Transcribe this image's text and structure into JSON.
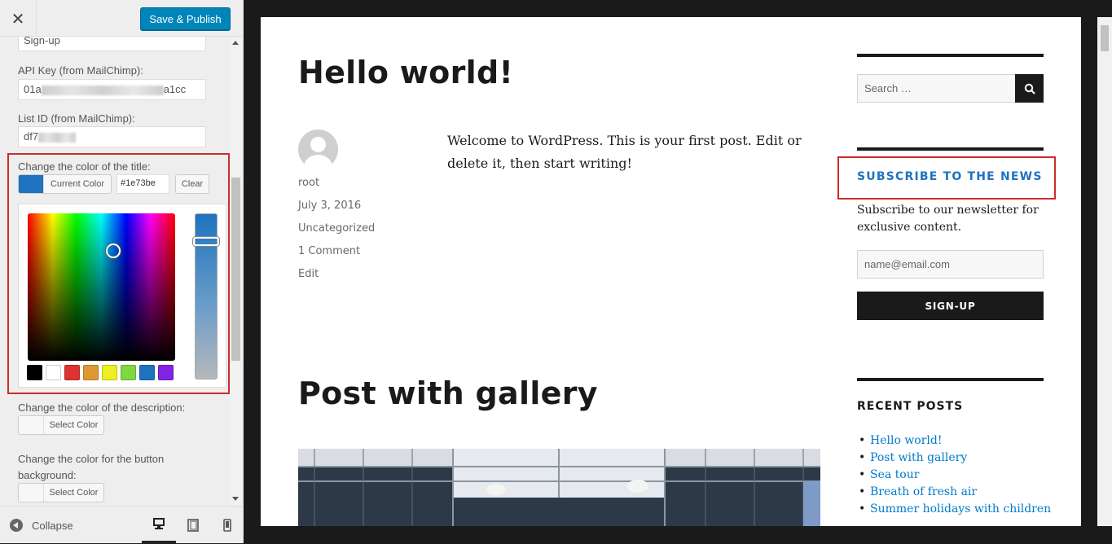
{
  "customizer": {
    "close_label": "✕",
    "publish_label": "Save & Publish",
    "fields": {
      "button_text_value": "Sign-up",
      "api_key_label": "API Key (from MailChimp):",
      "api_key_prefix": "01a",
      "api_key_suffix": "a1cc",
      "list_id_label": "List ID (from MailChimp):",
      "list_id_prefix": "df7"
    },
    "title_color": {
      "label": "Change the color of the title:",
      "button_label": "Current Color",
      "current_color": "#1e73be",
      "hex_value": "#1e73be",
      "clear_label": "Clear",
      "palette": [
        "#000000",
        "#ffffff",
        "#dd3333",
        "#dd9933",
        "#eeee22",
        "#81d742",
        "#1e73be",
        "#8224e3"
      ]
    },
    "description_color": {
      "label": "Change the color of the description:",
      "button_label": "Select Color"
    },
    "button_bg_color": {
      "label_line1": "Change the color for the button",
      "label_line2": "background:",
      "button_label": "Select Color"
    },
    "footer": {
      "collapse_label": "Collapse",
      "devices": [
        "desktop-icon",
        "tablet-icon",
        "mobile-icon"
      ]
    }
  },
  "preview": {
    "post1": {
      "title": "Hello world!",
      "author": "root",
      "date": "July 3, 2016",
      "category": "Uncategorized",
      "comments": "1 Comment",
      "edit": "Edit",
      "body": "Welcome to WordPress. This is your first post. Edit or delete it, then start writing!"
    },
    "post2": {
      "title": "Post with gallery"
    },
    "sidebar": {
      "search_placeholder": "Search …",
      "subscribe_title": "SUBSCRIBE TO THE NEWS",
      "subscribe_desc": "Subscribe to our newsletter for exclusive content.",
      "email_placeholder": "name@email.com",
      "signup_label": "SIGN-UP",
      "recent_title": "RECENT POSTS",
      "recent_posts": [
        "Hello world!",
        "Post with gallery",
        "Sea tour",
        "Breath of fresh air",
        "Summer holidays with children"
      ]
    }
  },
  "colors": {
    "title_accent": "#1e73be",
    "link": "#007acc",
    "highlight_border": "#cc2b2b",
    "publish_button": "#0085ba"
  }
}
